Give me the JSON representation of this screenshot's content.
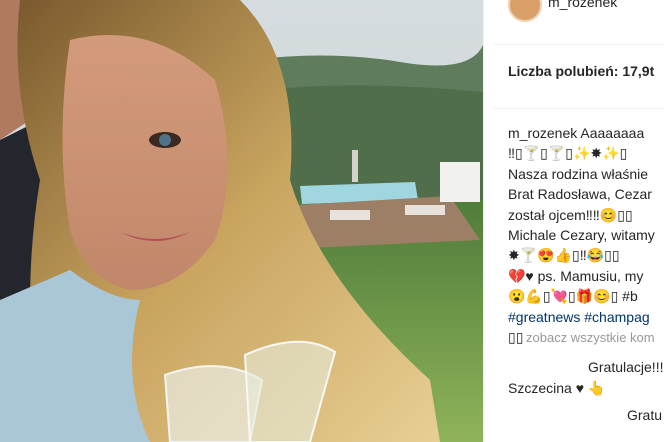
{
  "post": {
    "username_top": "m_rozenek",
    "likes_label": "Liczba polubień: 17,9t",
    "caption": {
      "user": "m_rozenek",
      "lines": [
        "Aaaaaaaa",
        "‼▯🍸▯🍸▯✨✸✨▯",
        "Nasza rodzina właśnie",
        "Brat Radosława, Cezar",
        "został ojcem‼‼😊▯▯",
        "Michale Cezary, witamy",
        "✸🍸😍👍▯‼😂▯▯",
        "💔♥ ps. Mamusiu, my",
        "😮💪▯💘▯🎁😊▯ #b",
        "#greatnews #champag",
        "▯▯"
      ]
    },
    "see_all": "zobacz wszystkie kom",
    "comments": [
      {
        "text": "Gratulacje!!!"
      },
      {
        "text": "Szczecina ♥ 👆"
      },
      {
        "text": "Gratu"
      }
    ]
  }
}
